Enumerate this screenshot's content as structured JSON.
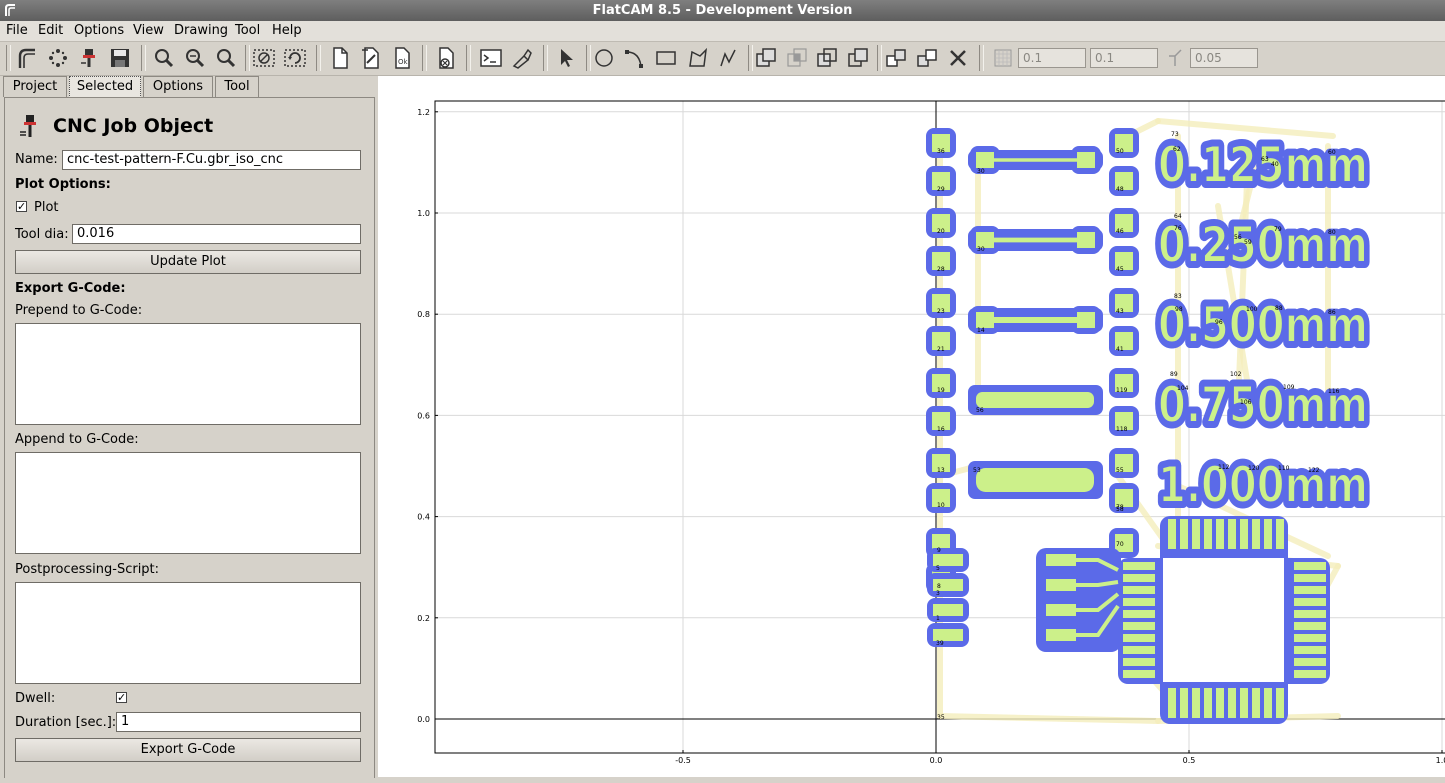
{
  "window": {
    "title": "FlatCAM 8.5 - Development Version"
  },
  "menu": [
    {
      "label": "File",
      "name": "menu-file"
    },
    {
      "label": "Edit",
      "name": "menu-edit"
    },
    {
      "label": "Options",
      "name": "menu-options"
    },
    {
      "label": "View",
      "name": "menu-view"
    },
    {
      "label": "Drawing",
      "name": "menu-drawing"
    },
    {
      "label": "Tool",
      "name": "menu-tool"
    },
    {
      "label": "Help",
      "name": "menu-help"
    }
  ],
  "toolbar": {
    "grid_x": "0.1",
    "grid_y": "0.1",
    "snap_max": "0.05"
  },
  "tabs": [
    {
      "label": "Project"
    },
    {
      "label": "Selected"
    },
    {
      "label": "Options"
    },
    {
      "label": "Tool"
    }
  ],
  "panel": {
    "title": "CNC Job Object",
    "name_label": "Name:",
    "name_value": "cnc-test-pattern-F.Cu.gbr_iso_cnc",
    "plot_options_label": "Plot Options:",
    "plot_label": "Plot",
    "plot_checked": true,
    "tool_dia_label": "Tool dia:",
    "tool_dia_value": "0.016",
    "update_plot_button": "Update Plot",
    "export_gcode_label": "Export G-Code:",
    "prepend_label": "Prepend to G-Code:",
    "append_label": "Append to G-Code:",
    "postprocessing_label": "Postprocessing-Script:",
    "dwell_label": "Dwell:",
    "dwell_checked": true,
    "duration_label": "Duration [sec.]:",
    "duration_value": "1",
    "export_gcode_button": "Export G-Code"
  },
  "plot": {
    "x_ticks": [
      "-0.5",
      "0.0",
      "0.5",
      "1.0"
    ],
    "y_ticks": [
      "1.2",
      "1.0",
      "0.8",
      "0.6",
      "0.4",
      "0.2",
      "0.0"
    ],
    "trace_labels": [
      "0.125mm",
      "0.250mm",
      "0.500mm",
      "0.750mm",
      "1.000mm"
    ],
    "pad_numbers": [
      "36",
      "29",
      "20",
      "28",
      "23",
      "21",
      "19",
      "16",
      "13",
      "10",
      "9",
      "8",
      "5",
      "3",
      "1",
      "39",
      "35",
      "30",
      "30",
      "14",
      "56",
      "53",
      "50",
      "48",
      "46",
      "45",
      "43",
      "41",
      "119",
      "118",
      "55",
      "58",
      "70",
      "78",
      "73",
      "62",
      "63",
      "40",
      "60",
      "64",
      "76",
      "56",
      "59",
      "79",
      "80",
      "83",
      "98",
      "96",
      "100",
      "88",
      "86",
      "89",
      "102",
      "104",
      "106",
      "109",
      "116",
      "112",
      "120",
      "110",
      "122"
    ],
    "colors": {
      "pad_fill": "#ccf08a",
      "isolation": "#5b6ae8",
      "travel": "#f5eebc"
    }
  }
}
